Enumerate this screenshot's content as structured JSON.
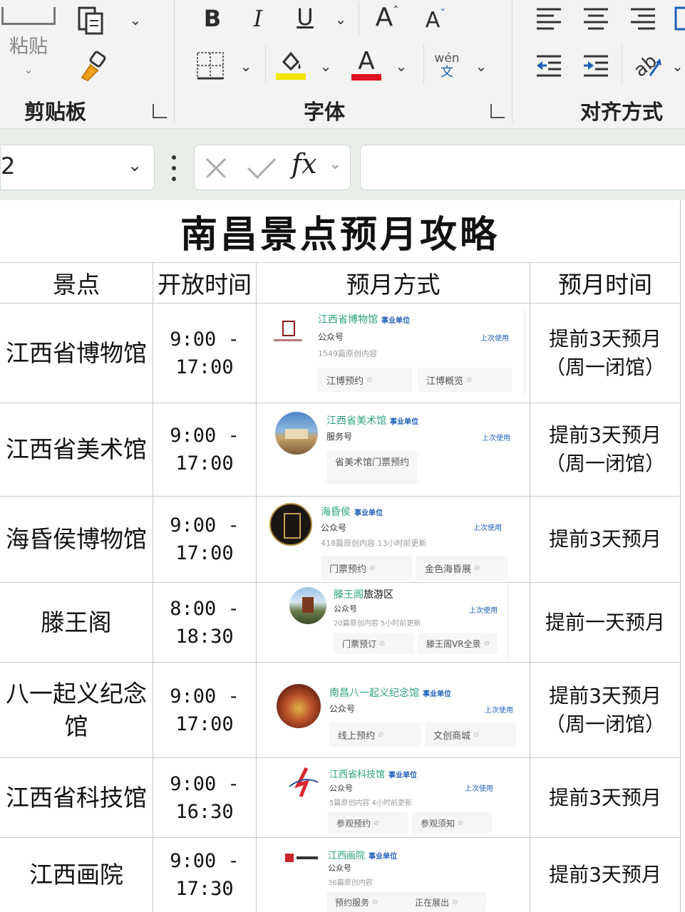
{
  "ribbon": {
    "paste_label": "粘贴",
    "groups": {
      "clipboard": "剪贴板",
      "font": "字体",
      "alignment": "对齐方式"
    },
    "bold": "B",
    "italic": "I",
    "underline": "U",
    "grow_font": "A",
    "shrink_font": "A",
    "phonetic_top": "wén",
    "phonetic_bottom": "文",
    "font_color_letter": "A"
  },
  "formula_bar": {
    "name_box_value": "2",
    "fx_label": "fx",
    "formula_value": ""
  },
  "sheet": {
    "title": "南昌景点预月攻略",
    "headers": [
      "景点",
      "开放时间",
      "预月方式",
      "预月时间"
    ],
    "rows": [
      {
        "name": "江西省博物馆",
        "open": "9:00 -",
        "close": "17:00",
        "when1": "提前3天预月",
        "when2": "（周一闭馆）",
        "card": {
          "name": "江西省博物馆",
          "name_suffix": "",
          "badge": "事业单位",
          "type": "公众号",
          "stats": "1549篇原创内容",
          "last_used": "上次使用",
          "buttons": [
            "江博预约",
            "江博概览"
          ]
        }
      },
      {
        "name": "江西省美术馆",
        "open": "9:00 -",
        "close": "17:00",
        "when1": "提前3天预月",
        "when2": "（周一闭馆）",
        "card": {
          "name": "江西省美术馆",
          "name_suffix": "",
          "badge": "事业单位",
          "type": "服务号",
          "stats": "",
          "last_used": "上次使用",
          "buttons": [
            "省美术馆门票预约"
          ]
        }
      },
      {
        "name": "海昏侯博物馆",
        "open": "9:00 -",
        "close": "17:00",
        "when1": "提前3天预月",
        "when2": "",
        "card": {
          "name": "海昏侯",
          "name_suffix": "",
          "badge": "事业单位",
          "type": "公众号",
          "stats": "418篇原创内容  13小时前更新",
          "last_used": "上次使用",
          "buttons": [
            "门票预约",
            "金色海昏展"
          ]
        }
      },
      {
        "name": "滕王阁",
        "open": "8:00 -",
        "close": "18:30",
        "when1": "提前一天预月",
        "when2": "",
        "card": {
          "name": "滕王阁",
          "name_suffix": "旅游区",
          "badge": "",
          "type": "公众号",
          "stats": "20篇原创内容  5小时前更新",
          "last_used": "上次使用",
          "buttons": [
            "门票预订",
            "滕王阁VR全景"
          ]
        }
      },
      {
        "name": "八一起义纪念馆",
        "open": "9:00 -",
        "close": "17:00",
        "when1": "提前3天预月",
        "when2": "（周一闭馆）",
        "card": {
          "name": "南昌八一起义纪念馆",
          "name_suffix": "",
          "badge": "事业单位",
          "type": "公众号",
          "stats": "",
          "last_used": "上次使用",
          "buttons": [
            "线上预约",
            "文创商城"
          ]
        }
      },
      {
        "name": "江西省科技馆",
        "open": "9:00 -",
        "close": "16:30",
        "when1": "提前3天预月",
        "when2": "",
        "card": {
          "name": "江西省科技馆",
          "name_suffix": "",
          "badge": "事业单位",
          "type": "公众号",
          "stats": "5篇原创内容  4小时前更新",
          "last_used": "上次使用",
          "buttons": [
            "参观预约",
            "参观须知"
          ]
        }
      },
      {
        "name": "江西画院",
        "open": "9:00 -",
        "close": "17:30",
        "when1": "提前3天预月",
        "when2": "",
        "card": {
          "name": "江西画院",
          "name_suffix": "",
          "badge": "事业单位",
          "type": "公众号",
          "stats": "36篇原创内容",
          "last_used": "",
          "buttons": [
            "预约服务",
            "正在展出"
          ]
        }
      }
    ]
  },
  "colors": {
    "ribbon_bg": "#f3f3f3",
    "formula_bar_bg": "#e8efe8",
    "highlight_yellow": "#f2e600",
    "font_red": "#e0141e",
    "account_green": "#2aa37a",
    "badge_blue": "#1d5fb8",
    "grid_line": "#c8c8c8"
  },
  "icons": [
    "copy-icon",
    "format-painter-icon",
    "borders-icon",
    "fill-color-icon",
    "font-color-icon",
    "align-left-icon",
    "align-center-icon",
    "align-right-icon",
    "decrease-indent-icon",
    "increase-indent-icon",
    "orientation-icon",
    "cancel-icon",
    "enter-icon",
    "chevron-down-icon"
  ]
}
